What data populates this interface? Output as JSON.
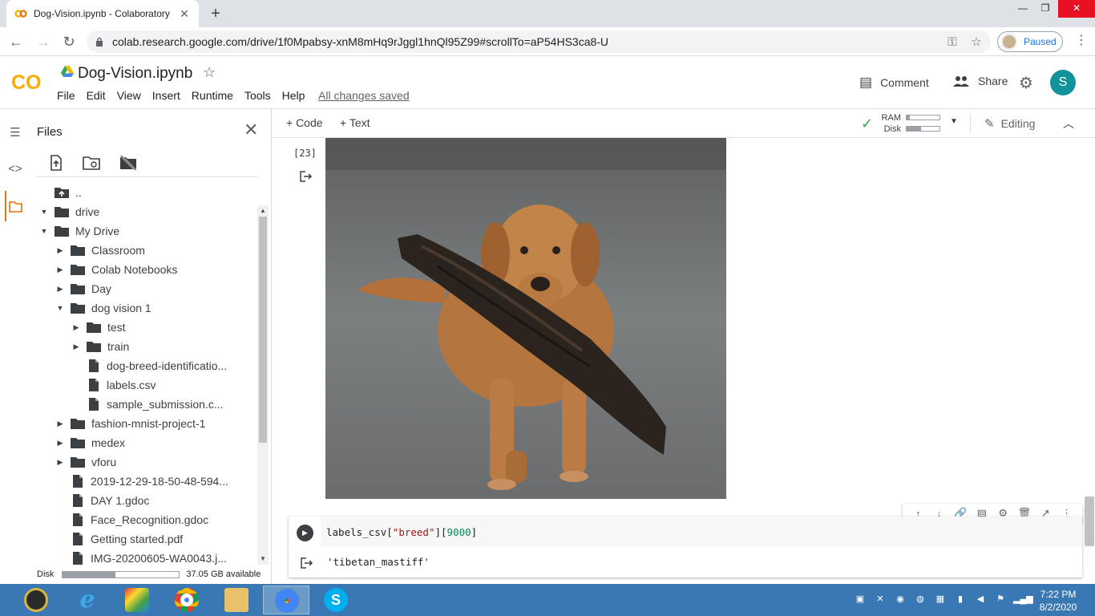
{
  "browser": {
    "tab_title": "Dog-Vision.ipynb - Colaboratory",
    "tab_close": "✕",
    "new_tab": "+",
    "url": "colab.research.google.com/drive/1f0Mpabsy-xnM8mHq9rJggl1hnQl95Z99#scrollTo=aP54HS3ca8-U",
    "profile_status": "Paused"
  },
  "colab": {
    "logo_text": "CO",
    "notebook_title": "Dog-Vision.ipynb",
    "menu": [
      "File",
      "Edit",
      "View",
      "Insert",
      "Runtime",
      "Tools",
      "Help"
    ],
    "save_status": "All changes saved",
    "comment_label": "Comment",
    "share_label": "Share",
    "user_initial": "S"
  },
  "files_panel": {
    "title": "Files",
    "tree": [
      {
        "label": "..",
        "type": "up",
        "depth": 0,
        "arrow": ""
      },
      {
        "label": "drive",
        "type": "folder",
        "depth": 0,
        "arrow": "▼"
      },
      {
        "label": "My Drive",
        "type": "folder",
        "depth": 1,
        "arrow": "▼"
      },
      {
        "label": "Classroom",
        "type": "folder",
        "depth": 2,
        "arrow": "▶"
      },
      {
        "label": "Colab Notebooks",
        "type": "folder",
        "depth": 2,
        "arrow": "▶"
      },
      {
        "label": "Day",
        "type": "folder",
        "depth": 2,
        "arrow": "▶"
      },
      {
        "label": "dog vision 1",
        "type": "folder",
        "depth": 2,
        "arrow": "▼"
      },
      {
        "label": "test",
        "type": "folder",
        "depth": 3,
        "arrow": "▶"
      },
      {
        "label": "train",
        "type": "folder",
        "depth": 3,
        "arrow": "▶"
      },
      {
        "label": "dog-breed-identificatio...",
        "type": "file",
        "depth": 3,
        "arrow": ""
      },
      {
        "label": "labels.csv",
        "type": "file",
        "depth": 3,
        "arrow": ""
      },
      {
        "label": "sample_submission.c...",
        "type": "file",
        "depth": 3,
        "arrow": ""
      },
      {
        "label": "fashion-mnist-project-1",
        "type": "folder",
        "depth": 2,
        "arrow": "▶"
      },
      {
        "label": "medex",
        "type": "folder",
        "depth": 2,
        "arrow": "▶"
      },
      {
        "label": "vforu",
        "type": "folder",
        "depth": 2,
        "arrow": "▶"
      },
      {
        "label": "2019-12-29-18-50-48-594...",
        "type": "file",
        "depth": 2,
        "arrow": ""
      },
      {
        "label": "DAY 1.gdoc",
        "type": "file",
        "depth": 2,
        "arrow": ""
      },
      {
        "label": "Face_Recognition.gdoc",
        "type": "file",
        "depth": 2,
        "arrow": ""
      },
      {
        "label": "Getting started.pdf",
        "type": "file",
        "depth": 2,
        "arrow": ""
      },
      {
        "label": "IMG-20200605-WA0043.j...",
        "type": "file",
        "depth": 2,
        "arrow": ""
      }
    ],
    "disk_label": "Disk",
    "disk_available": "37.05 GB available",
    "disk_used_fraction": 0.45
  },
  "notebook_toolbar": {
    "add_code": "+ Code",
    "add_text": "+ Text",
    "ram_label": "RAM",
    "disk_label": "Disk",
    "ram_fraction": 0.1,
    "disk_fraction": 0.45,
    "editing_label": "Editing"
  },
  "cells": {
    "image_cell_count": "[23]",
    "code_prefix": "labels_csv[",
    "code_str": "\"breed\"",
    "code_mid": "][",
    "code_num": "9000",
    "code_suffix": "]",
    "output_text": "'tibetan_mastiff'"
  },
  "taskbar": {
    "time": "7:22 PM",
    "date": "8/2/2020"
  },
  "colors": {
    "colab_orange": "#f9ab00",
    "accent_teal": "#12939a",
    "taskbar_blue": "#3a78b4"
  }
}
